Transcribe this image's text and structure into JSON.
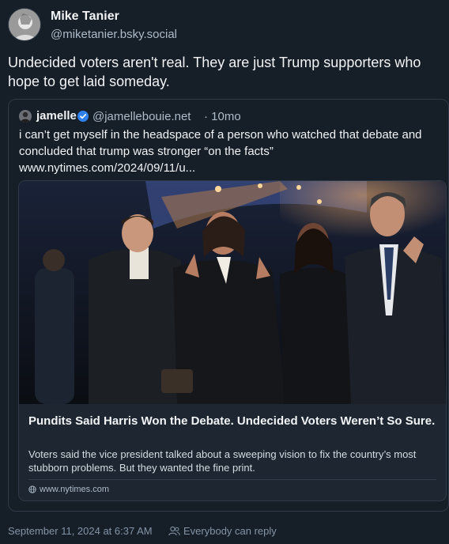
{
  "author": {
    "display_name": "Mike Tanier",
    "handle": "@miketanier.bsky.social",
    "avatar_icon": "user-avatar-icon"
  },
  "post": {
    "text": "Undecided voters aren't real. They are just Trump supporters who hope to get laid someday."
  },
  "quote": {
    "display_name": "jamelle",
    "verified_icon": "verified-check-icon",
    "handle": "@jamellebouie.net",
    "time": "· 10mo",
    "text": "i can’t get myself in the headspace of a person who watched that debate and concluded that trump was stronger “on the facts”",
    "link": "www.nytimes.com/2024/09/11/u...",
    "card": {
      "title": "Pundits Said Harris Won the Debate. Undecided Voters Weren’t So Sure.",
      "description": "Voters said the vice president talked about a sweeping vision to fix the country’s most stubborn problems. But they wanted the fine print.",
      "domain": "www.nytimes.com",
      "domain_icon": "globe-icon"
    }
  },
  "footer": {
    "timestamp": "September 11, 2024 at 6:37 AM",
    "reply_setting": "Everybody can reply",
    "reply_icon": "people-icon"
  },
  "colors": {
    "background": "#161e27",
    "border": "#2e3a47",
    "muted_text": "#aebbc9",
    "verified_blue": "#2f80ed"
  }
}
